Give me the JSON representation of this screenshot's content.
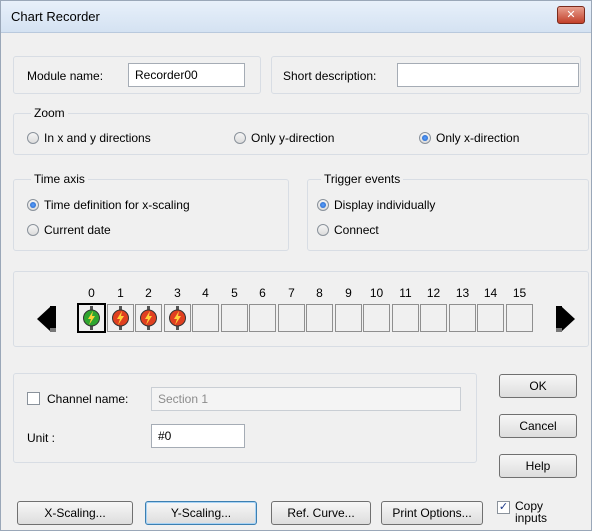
{
  "window": {
    "title": "Chart Recorder"
  },
  "module": {
    "name_label": "Module name:",
    "name_value": "Recorder00",
    "desc_label": "Short description:",
    "desc_value": ""
  },
  "zoom": {
    "title": "Zoom",
    "options": [
      {
        "label": "In x and y directions",
        "selected": false
      },
      {
        "label": "Only y-direction",
        "selected": false
      },
      {
        "label": "Only x-direction",
        "selected": true
      }
    ]
  },
  "time_axis": {
    "title": "Time axis",
    "options": [
      {
        "label": "Time definition for x-scaling",
        "selected": true
      },
      {
        "label": "Current date",
        "selected": false
      }
    ]
  },
  "trigger": {
    "title": "Trigger events",
    "options": [
      {
        "label": "Display individually",
        "selected": true
      },
      {
        "label": "Connect",
        "selected": false
      }
    ]
  },
  "channels": {
    "numbers": [
      "0",
      "1",
      "2",
      "3",
      "4",
      "5",
      "6",
      "7",
      "8",
      "9",
      "10",
      "11",
      "12",
      "13",
      "14",
      "15"
    ],
    "active": [
      true,
      true,
      true,
      true,
      false,
      false,
      false,
      false,
      false,
      false,
      false,
      false,
      false,
      false,
      false,
      false
    ],
    "selected_index": 0,
    "colors": [
      "#2fa52f",
      "#e04020",
      "#e04020",
      "#e04020"
    ]
  },
  "channel": {
    "name_label": "Channel name:",
    "name_value": "Section 1",
    "name_checked": false,
    "unit_label": "Unit :",
    "unit_value": "#0"
  },
  "buttons": {
    "ok": "OK",
    "cancel": "Cancel",
    "help": "Help",
    "x_scaling": "X-Scaling...",
    "y_scaling": "Y-Scaling...",
    "ref_curve": "Ref. Curve...",
    "print_options": "Print Options..."
  },
  "copy_inputs": {
    "label_line1": "Copy",
    "label_line2": "inputs",
    "checked": true
  }
}
